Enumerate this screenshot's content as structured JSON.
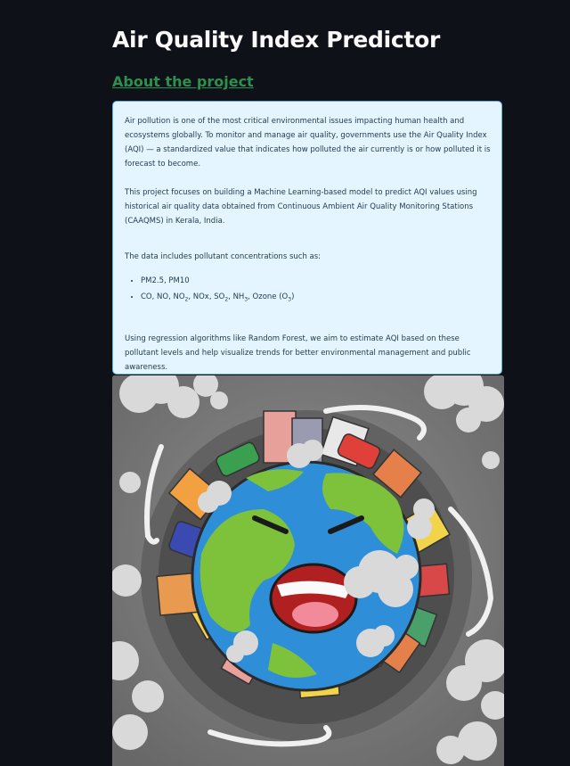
{
  "page": {
    "title": "Air Quality Index Predictor",
    "about_link": "About the project"
  },
  "info": {
    "p1": "Air pollution is one of the most critical environmental issues impacting human health and ecosystems globally. To monitor and manage air quality, governments use the Air Quality Index (AQI) — a standardized value that indicates how polluted the air currently is or how polluted it is forecast to become.",
    "p2": "This project focuses on building a Machine Learning-based model to predict AQI values using historical air quality data obtained from Continuous Ambient Air Quality Monitoring Stations (CAAQMS) in Kerala, India.",
    "p3": "The data includes pollutant concentrations such as:",
    "bullet1": "PM2.5, PM10",
    "bullet2": {
      "co_no": "CO, NO, NO",
      "no2_sub": "2",
      "nox_so": ", NOx, SO",
      "so2_sub": "2",
      "nh": ", NH",
      "nh3_sub": "3",
      "ozone": ", Ozone (O",
      "o3_sub": "3",
      "close": ")"
    },
    "p4": "Using regression algorithms like Random Forest, we aim to estimate AQI based on these pollutant levels and help visualize trends for better environmental management and public awareness."
  },
  "colors": {
    "background": "#0e1117",
    "link": "#2f8f4e",
    "info_bg": "#e4f5ff",
    "info_border": "#5bb0e0",
    "info_text": "#1e3a4a"
  },
  "image": {
    "subject": "polluted-earth-illustration"
  }
}
